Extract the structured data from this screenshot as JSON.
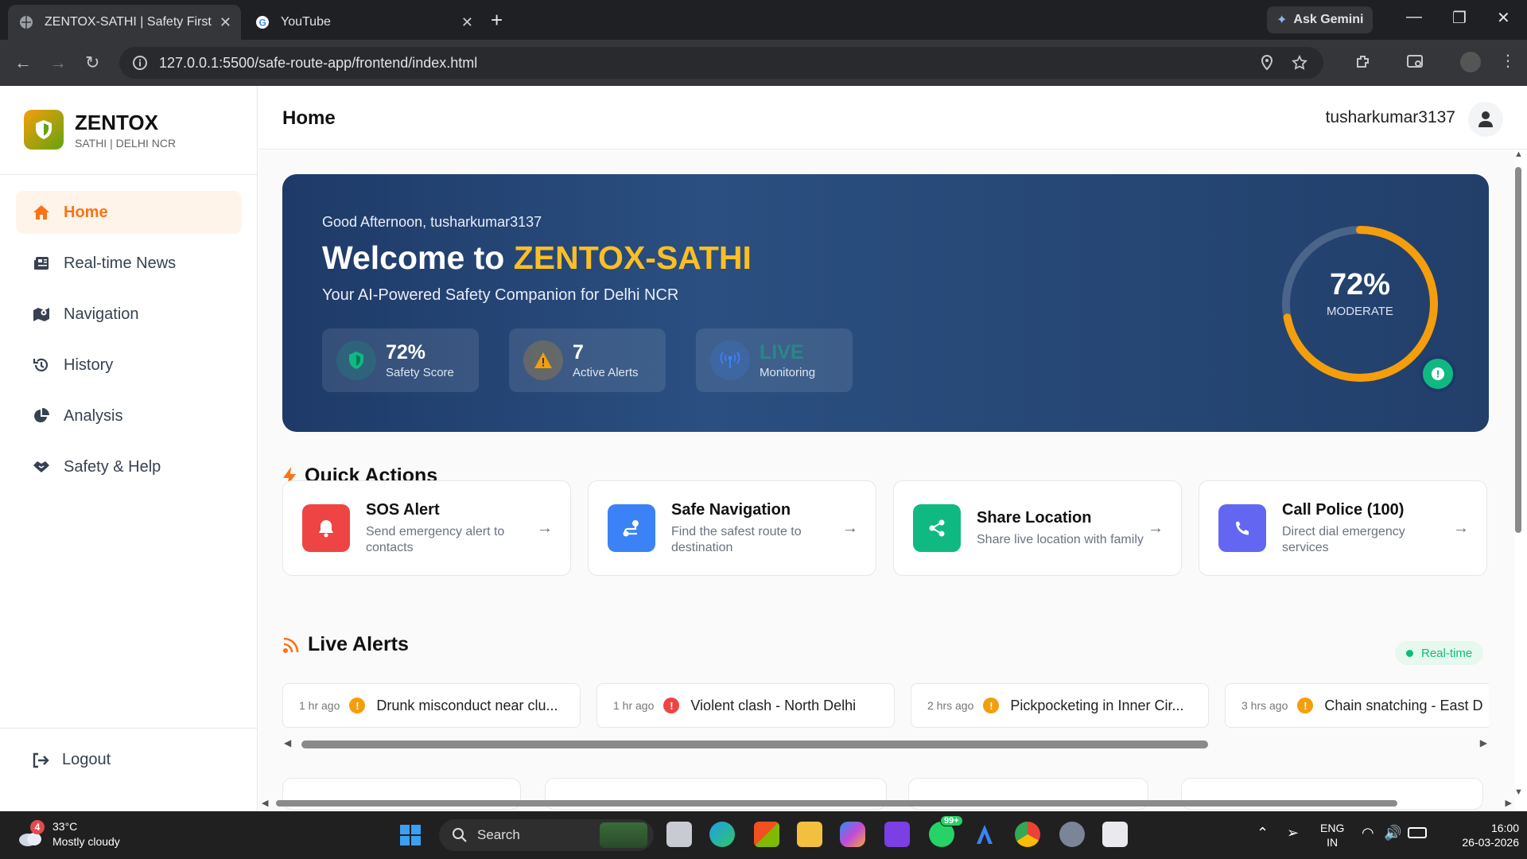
{
  "browser": {
    "tabs": [
      {
        "title": "ZENTOX-SATHI | Safety First",
        "active": true
      },
      {
        "title": "YouTube",
        "active": false
      }
    ],
    "ask_gemini": "Ask Gemini",
    "url": "127.0.0.1:5500/safe-route-app/frontend/index.html"
  },
  "sidebar": {
    "brand_name": "ZENTOX",
    "brand_sub": "SATHI | DELHI NCR",
    "items": [
      {
        "label": "Home",
        "icon": "home-icon",
        "active": true
      },
      {
        "label": "Real-time News",
        "icon": "newspaper-icon"
      },
      {
        "label": "Navigation",
        "icon": "map-icon"
      },
      {
        "label": "History",
        "icon": "history-icon"
      },
      {
        "label": "Analysis",
        "icon": "pie-chart-icon"
      },
      {
        "label": "Safety & Help",
        "icon": "handshake-icon"
      }
    ],
    "logout": "Logout"
  },
  "header": {
    "title": "Home",
    "username": "tusharkumar3137"
  },
  "hero": {
    "greeting": "Good Afternoon, tusharkumar3137",
    "welcome_prefix": "Welcome to ",
    "welcome_brand": "ZENTOX-SATHI",
    "tagline": "Your AI-Powered Safety Companion for Delhi NCR",
    "stats": [
      {
        "value": "72%",
        "label": "Safety Score",
        "color": "#10b981"
      },
      {
        "value": "7",
        "label": "Active Alerts",
        "color": "#f59e0b"
      },
      {
        "value": "LIVE",
        "label": "Monitoring",
        "color": "#3b82f6"
      }
    ],
    "gauge": {
      "value": "72%",
      "level": "MODERATE",
      "fraction": 0.72,
      "color": "#f59e0b"
    }
  },
  "quick_actions": {
    "title": "Quick Actions",
    "items": [
      {
        "title": "SOS Alert",
        "desc": "Send emergency alert to contacts",
        "color": "#ef4444",
        "icon": "bell-icon"
      },
      {
        "title": "Safe Navigation",
        "desc": "Find the safest route to destination",
        "color": "#3b82f6",
        "icon": "route-icon"
      },
      {
        "title": "Share Location",
        "desc": "Share live location with family",
        "color": "#10b981",
        "icon": "share-icon"
      },
      {
        "title": "Call Police (100)",
        "desc": "Direct dial emergency services",
        "color": "#6366f1",
        "icon": "phone-icon"
      }
    ]
  },
  "live_alerts": {
    "title": "Live Alerts",
    "badge": "Real-time",
    "items": [
      {
        "time": "1 hr ago",
        "title": "Drunk misconduct near clu...",
        "color": "#f59e0b"
      },
      {
        "time": "1 hr ago",
        "title": "Violent clash - North Delhi",
        "color": "#ef4444"
      },
      {
        "time": "2 hrs ago",
        "title": "Pickpocketing in Inner Cir...",
        "color": "#f59e0b"
      },
      {
        "time": "3 hrs ago",
        "title": "Chain snatching - East D",
        "color": "#f59e0b"
      }
    ]
  },
  "taskbar": {
    "weather_badge": "4",
    "temp": "33°C",
    "condition": "Mostly cloudy",
    "search": "Search",
    "whatsapp_badge": "99+",
    "lang1": "ENG",
    "lang2": "IN",
    "time": "16:00",
    "date": "26-03-2026"
  }
}
